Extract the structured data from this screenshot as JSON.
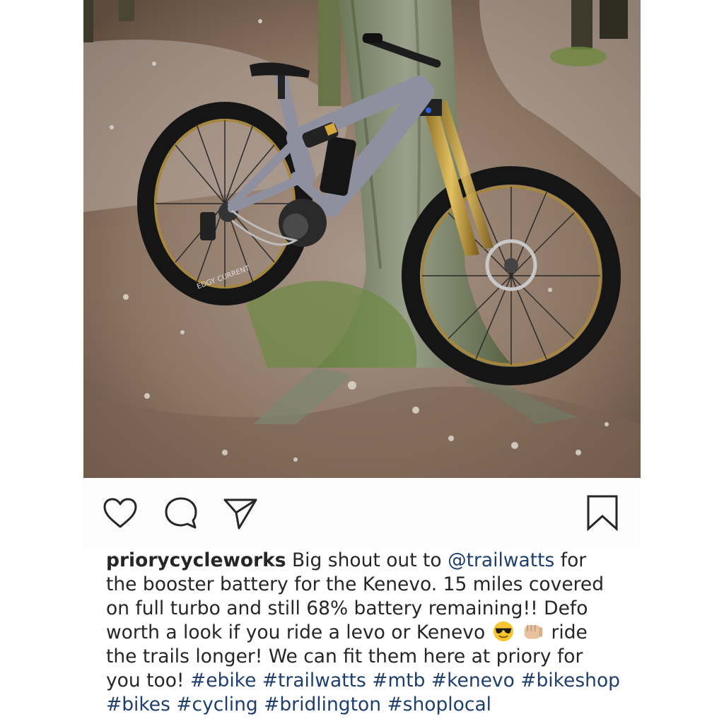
{
  "post": {
    "image_alt": "Specialized Kenevo electric mountain bike leaning against a tree on a forest trail",
    "tire_text": "EDGY CURRENT",
    "actions": {
      "like_icon": "heart-icon",
      "comment_icon": "comment-icon",
      "share_icon": "share-icon",
      "save_icon": "bookmark-icon"
    },
    "caption": {
      "username": "priorycycleworks",
      "text_1": " Big shout out to ",
      "mention": "@trailwatts",
      "text_2": " for the booster battery for the Kenevo. 15 miles covered on full turbo and still 68% battery remaining!! Defo worth a look if you ride a levo or Kenevo ",
      "emoji_1": "sunglasses-emoji",
      "emoji_2": "fist-bump-emoji",
      "text_3": " ride the trails longer! We can fit them here at priory for you too! ",
      "hashtags": [
        "#ebike",
        "#trailwatts",
        "#mtb",
        "#kenevo",
        "#bikeshop",
        "#bikes",
        "#cycling",
        "#bridlington",
        "#shoplocal"
      ]
    }
  },
  "colors": {
    "text": "#262626",
    "link": "#1e3f6e",
    "bike_frame": "#8e90a0"
  }
}
